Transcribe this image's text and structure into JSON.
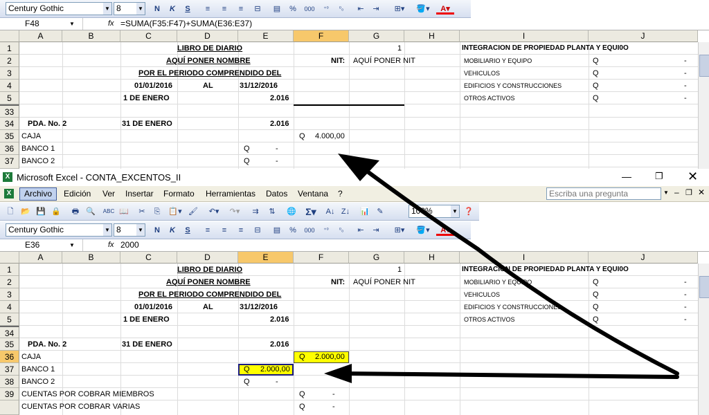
{
  "top": {
    "font_name": "Century Gothic",
    "font_size": "8",
    "cell_ref": "F48",
    "formula": "=SUMA(F35:F47)+SUMA(E36:E37)",
    "columns": [
      "A",
      "B",
      "C",
      "D",
      "E",
      "F",
      "G",
      "H",
      "I",
      "J"
    ],
    "rows": [
      "1",
      "2",
      "3",
      "4",
      "5",
      "33",
      "34",
      "35",
      "36",
      "37"
    ],
    "cells": {
      "d1": "LIBRO DE DIARIO",
      "f1": "1",
      "i1": "INTEGRACION DE PROPIEDAD PLANTA Y EQUI0O",
      "d2": "AQUÍ PONER NOMBRE",
      "f2": "NIT:",
      "g2": "AQUÍ PONER NIT",
      "i2": "MOBILIARIO Y EQUIPO",
      "j2q": "Q",
      "j2v": "-",
      "d3": "POR EL PERIODO COMPRENDIDO DEL",
      "i3": "VEHICULOS",
      "j3q": "Q",
      "j3v": "-",
      "c4": "01/01/2016",
      "d4": "AL",
      "e4": "31/12/2016",
      "i4": "EDIFICIOS Y CONSTRUCCIONES",
      "j4q": "Q",
      "j4v": "-",
      "c5": "1 DE ENERO",
      "e5": "2.016",
      "i5": "OTROS ACTIVOS",
      "j5q": "Q",
      "j5v": "-",
      "a34": "PDA. No. 2",
      "c34": "31 DE ENERO",
      "e34": "2.016",
      "a35": "CAJA",
      "f35q": "Q",
      "f35v": "4.000,00",
      "a36": "BANCO 1",
      "e36q": "Q",
      "e36v": "-",
      "a37": "BANCO 2",
      "e37q": "Q",
      "e37v": "-"
    }
  },
  "window": {
    "title": "Microsoft Excel - CONTA_EXCENTOS_II",
    "menu": [
      "Archivo",
      "Edición",
      "Ver",
      "Insertar",
      "Formato",
      "Herramientas",
      "Datos",
      "Ventana",
      "?"
    ],
    "help_placeholder": "Escriba una pregunta",
    "zoom": "100%",
    "font_name": "Century Gothic",
    "font_size": "8"
  },
  "bottom": {
    "cell_ref": "E36",
    "formula": "2000",
    "columns": [
      "A",
      "B",
      "C",
      "D",
      "E",
      "F",
      "G",
      "H",
      "I",
      "J"
    ],
    "rows": [
      "1",
      "2",
      "3",
      "4",
      "5",
      "34",
      "35",
      "36",
      "37",
      "38",
      "39"
    ],
    "cells": {
      "d1": "LIBRO DE DIARIO",
      "f1": "1",
      "i1": "INTEGRACION DE PROPIEDAD PLANTA Y EQUI0O",
      "d2": "AQUÍ PONER NOMBRE",
      "f2": "NIT:",
      "g2": "AQUÍ PONER NIT",
      "i2": "MOBILIARIO Y EQUIPO",
      "j2q": "Q",
      "j2v": "-",
      "d3": "POR EL PERIODO COMPRENDIDO DEL",
      "i3": "VEHICULOS",
      "j3q": "Q",
      "j3v": "-",
      "c4": "01/01/2016",
      "d4": "AL",
      "e4": "31/12/2016",
      "i4": "EDIFICIOS Y CONSTRUCCIONES",
      "j4q": "Q",
      "j4v": "-",
      "c5": "1 DE ENERO",
      "e5": "2.016",
      "i5": "OTROS ACTIVOS",
      "j5q": "Q",
      "j5v": "-",
      "a34": "PDA. No. 2",
      "c34": "31 DE ENERO",
      "e34": "2.016",
      "a35": "CAJA",
      "f35q": "Q",
      "f35v": "2.000,00",
      "a36": "BANCO 1",
      "e36q": "Q",
      "e36v": "2.000,00",
      "a37": "BANCO 2",
      "e37q": "Q",
      "e37v": "-",
      "a38": "CUENTAS POR COBRAR MIEMBROS",
      "f38q": "Q",
      "f38v": "-",
      "a39": "CUENTAS POR COBRAR VARIAS",
      "f39q": "Q",
      "f39v": "-"
    }
  },
  "colors": {
    "highlight": "#ffff00",
    "selection_border": "#1a1a80",
    "arrow": "#000000"
  }
}
